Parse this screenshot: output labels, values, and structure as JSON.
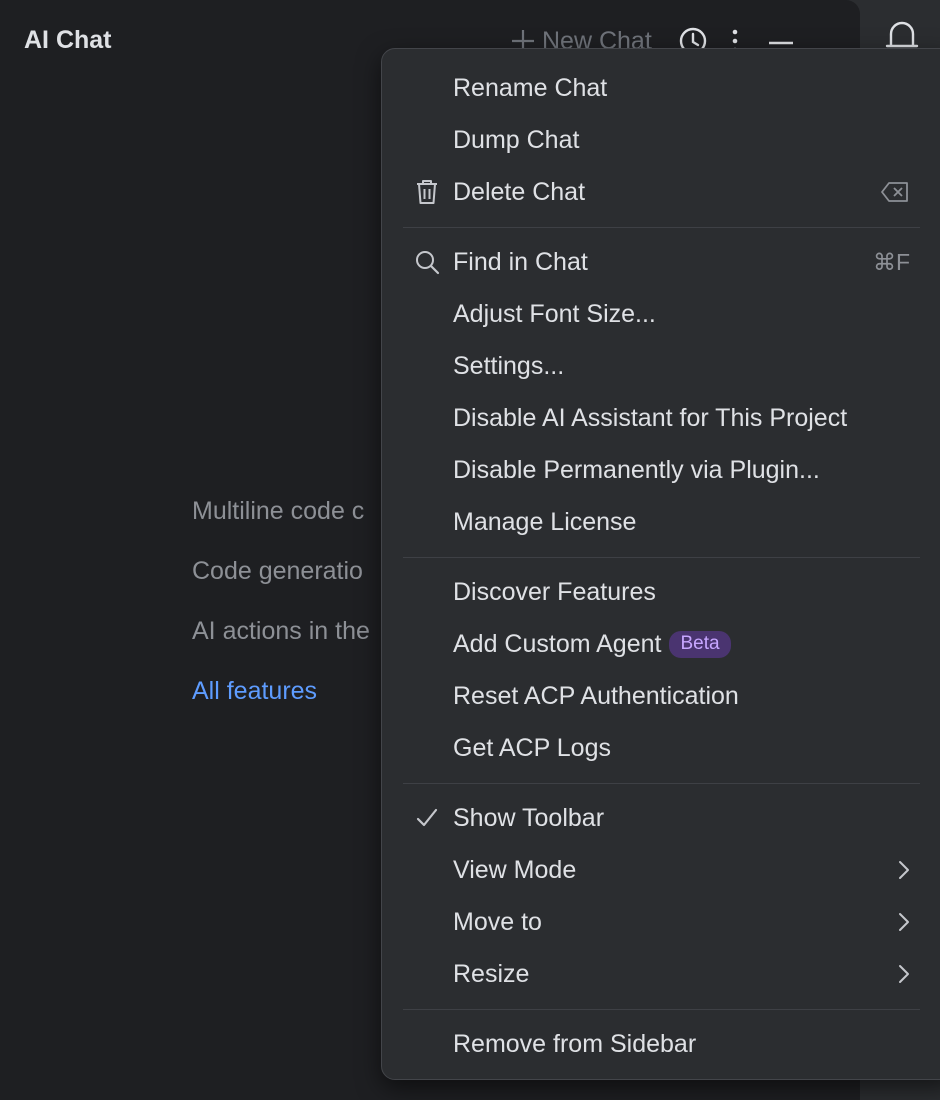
{
  "panel": {
    "title": "AI Chat",
    "new_chat_label": "New Chat"
  },
  "icons": {
    "new_chat": "plus-icon",
    "history": "clock-icon",
    "more": "vertical-ellipsis-icon",
    "minimize": "minus-icon",
    "notifications": "bell-icon",
    "delete": "trash-icon",
    "delete_shortcut": "backspace-key-icon",
    "find": "search-icon",
    "check": "checkmark-icon",
    "submenu": "chevron-right-icon"
  },
  "features": [
    "Multiline code c",
    "Code generatio",
    "AI actions in the"
  ],
  "features_link": "All features",
  "menu": {
    "group1": {
      "rename": "Rename Chat",
      "dump": "Dump Chat",
      "delete": "Delete Chat"
    },
    "group2": {
      "find": "Find in Chat",
      "find_shortcut": "⌘F",
      "font": "Adjust Font Size...",
      "settings": "Settings...",
      "disable_project": "Disable AI Assistant for This Project",
      "disable_plugin": "Disable Permanently via Plugin...",
      "license": "Manage License"
    },
    "group3": {
      "discover": "Discover Features",
      "custom_agent": "Add Custom Agent",
      "custom_agent_badge": "Beta",
      "reset_acp": "Reset ACP Authentication",
      "acp_logs": "Get ACP Logs"
    },
    "group4": {
      "show_toolbar": "Show Toolbar",
      "show_toolbar_checked": true,
      "view_mode": "View Mode",
      "move_to": "Move to",
      "resize": "Resize"
    },
    "group5": {
      "remove": "Remove from Sidebar"
    }
  },
  "colors": {
    "panel_bg": "#1e1f22",
    "menu_bg": "#2b2d30",
    "text": "#dfe1e5",
    "muted": "#8d9096",
    "link": "#5e9cff",
    "badge_bg": "#4a3470",
    "badge_text": "#c7a6ff"
  }
}
